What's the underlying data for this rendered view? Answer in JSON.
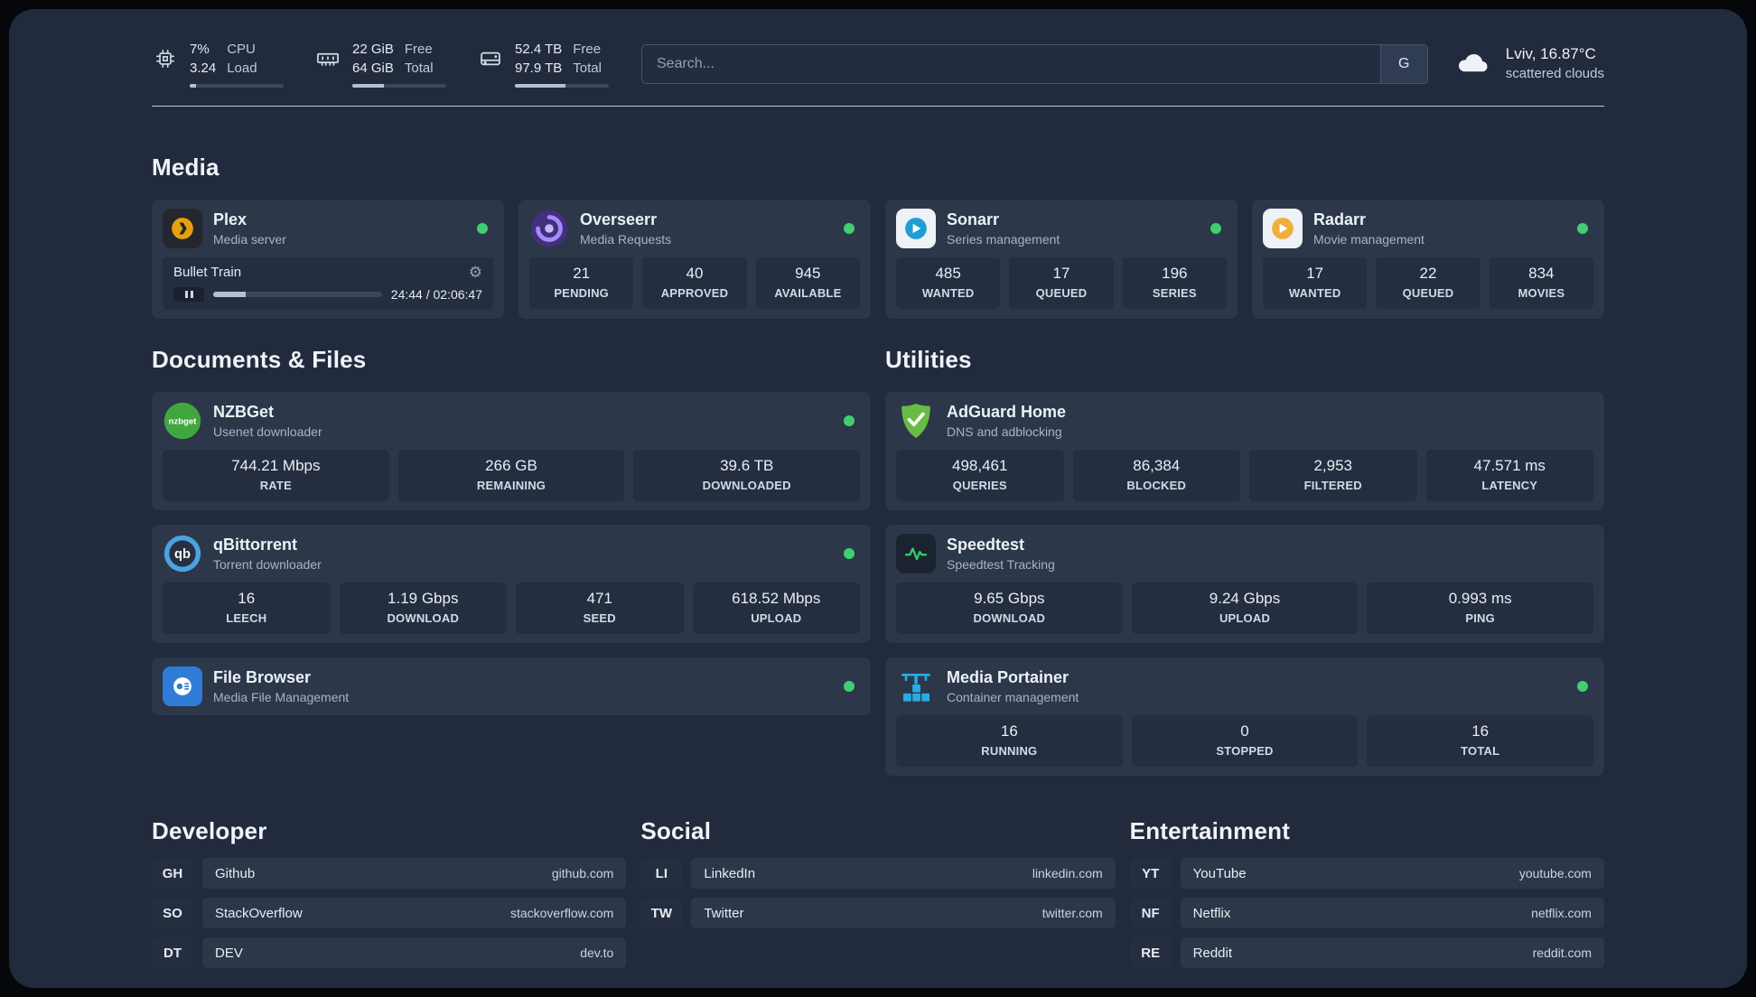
{
  "colors": {
    "status_online": "#3fcf70"
  },
  "header": {
    "cpu": {
      "top_value": "7%",
      "bottom_value": "3.24",
      "top_label": "CPU",
      "bottom_label": "Load",
      "bar_percent": 7
    },
    "ram": {
      "top_value": "22 GiB",
      "bottom_value": "64 GiB",
      "top_label": "Free",
      "bottom_label": "Total",
      "bar_percent": 34
    },
    "disk": {
      "top_value": "52.4 TB",
      "bottom_value": "97.9 TB",
      "top_label": "Free",
      "bottom_label": "Total",
      "bar_percent": 54
    },
    "search": {
      "placeholder": "Search...",
      "engine_label": "G"
    },
    "weather": {
      "location": "Lviv, 16.87°C",
      "condition": "scattered clouds"
    }
  },
  "sections": {
    "media": {
      "title": "Media",
      "plex": {
        "name": "Plex",
        "subtitle": "Media server",
        "player": {
          "track": "Bullet Train",
          "time": "24:44 / 02:06:47",
          "progress_percent": 19.5
        }
      },
      "overseerr": {
        "name": "Overseerr",
        "subtitle": "Media Requests",
        "stats": [
          {
            "value": "21",
            "label": "PENDING"
          },
          {
            "value": "40",
            "label": "APPROVED"
          },
          {
            "value": "945",
            "label": "AVAILABLE"
          }
        ]
      },
      "sonarr": {
        "name": "Sonarr",
        "subtitle": "Series management",
        "stats": [
          {
            "value": "485",
            "label": "WANTED"
          },
          {
            "value": "17",
            "label": "QUEUED"
          },
          {
            "value": "196",
            "label": "SERIES"
          }
        ]
      },
      "radarr": {
        "name": "Radarr",
        "subtitle": "Movie management",
        "stats": [
          {
            "value": "17",
            "label": "WANTED"
          },
          {
            "value": "22",
            "label": "QUEUED"
          },
          {
            "value": "834",
            "label": "MOVIES"
          }
        ]
      }
    },
    "documents": {
      "title": "Documents & Files",
      "nzbget": {
        "name": "NZBGet",
        "subtitle": "Usenet downloader",
        "icon_text": "nzbget",
        "stats": [
          {
            "value": "744.21 Mbps",
            "label": "RATE"
          },
          {
            "value": "266 GB",
            "label": "REMAINING"
          },
          {
            "value": "39.6 TB",
            "label": "DOWNLOADED"
          }
        ]
      },
      "qbittorrent": {
        "name": "qBittorrent",
        "subtitle": "Torrent downloader",
        "icon_text": "qb",
        "stats": [
          {
            "value": "16",
            "label": "LEECH"
          },
          {
            "value": "1.19 Gbps",
            "label": "DOWNLOAD"
          },
          {
            "value": "471",
            "label": "SEED"
          },
          {
            "value": "618.52 Mbps",
            "label": "UPLOAD"
          }
        ]
      },
      "filebrowser": {
        "name": "File Browser",
        "subtitle": "Media File Management"
      }
    },
    "utilities": {
      "title": "Utilities",
      "adguard": {
        "name": "AdGuard Home",
        "subtitle": "DNS and adblocking",
        "stats": [
          {
            "value": "498,461",
            "label": "QUERIES"
          },
          {
            "value": "86,384",
            "label": "BLOCKED"
          },
          {
            "value": "2,953",
            "label": "FILTERED"
          },
          {
            "value": "47.571 ms",
            "label": "LATENCY"
          }
        ]
      },
      "speedtest": {
        "name": "Speedtest",
        "subtitle": "Speedtest Tracking",
        "stats": [
          {
            "value": "9.65 Gbps",
            "label": "DOWNLOAD"
          },
          {
            "value": "9.24 Gbps",
            "label": "UPLOAD"
          },
          {
            "value": "0.993 ms",
            "label": "PING"
          }
        ]
      },
      "portainer": {
        "name": "Media Portainer",
        "subtitle": "Container management",
        "stats": [
          {
            "value": "16",
            "label": "RUNNING"
          },
          {
            "value": "0",
            "label": "STOPPED"
          },
          {
            "value": "16",
            "label": "TOTAL"
          }
        ]
      }
    },
    "links": {
      "developer": {
        "title": "Developer",
        "items": [
          {
            "abbr": "GH",
            "name": "Github",
            "url": "github.com"
          },
          {
            "abbr": "SO",
            "name": "StackOverflow",
            "url": "stackoverflow.com"
          },
          {
            "abbr": "DT",
            "name": "DEV",
            "url": "dev.to"
          }
        ]
      },
      "social": {
        "title": "Social",
        "items": [
          {
            "abbr": "LI",
            "name": "LinkedIn",
            "url": "linkedin.com"
          },
          {
            "abbr": "TW",
            "name": "Twitter",
            "url": "twitter.com"
          }
        ]
      },
      "entertainment": {
        "title": "Entertainment",
        "items": [
          {
            "abbr": "YT",
            "name": "YouTube",
            "url": "youtube.com"
          },
          {
            "abbr": "NF",
            "name": "Netflix",
            "url": "netflix.com"
          },
          {
            "abbr": "RE",
            "name": "Reddit",
            "url": "reddit.com"
          }
        ]
      }
    }
  }
}
